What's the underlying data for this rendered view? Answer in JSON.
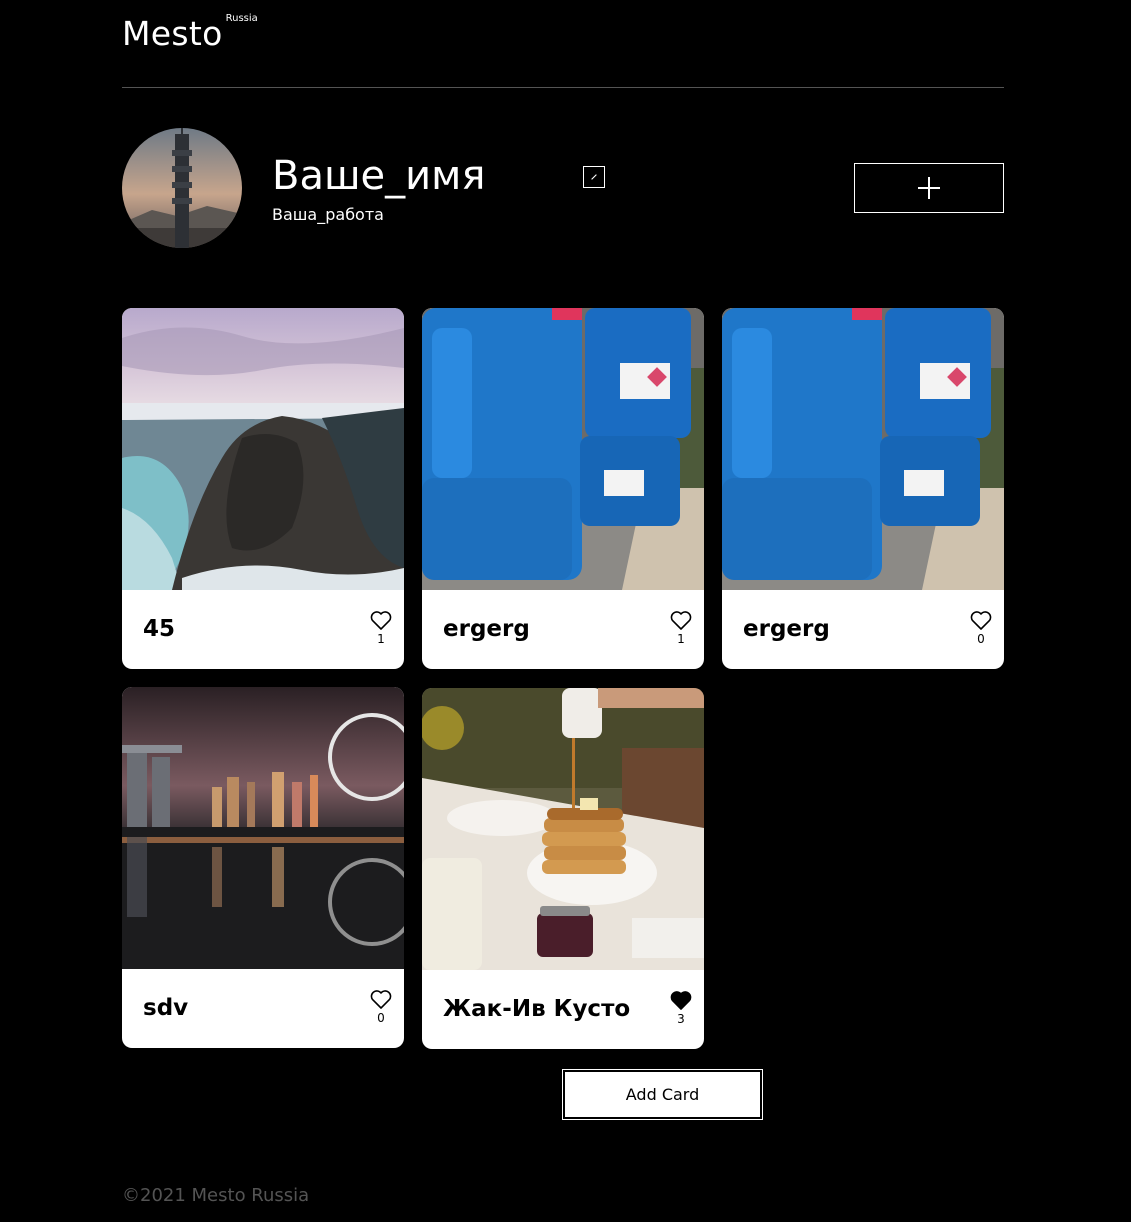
{
  "header": {
    "logo": "Mesto",
    "logo_sup": "Russia"
  },
  "profile": {
    "name": "Ваше_имя",
    "job": "Ваша_работа",
    "edit_icon": "pencil-icon",
    "add_icon": "plus-icon"
  },
  "cards": [
    {
      "title": "45",
      "likes": "1",
      "liked": false,
      "image": "snowy-cliff-photo"
    },
    {
      "title": "ergerg",
      "likes": "1",
      "liked": false,
      "image": "blue-canisters-photo"
    },
    {
      "title": "ergerg",
      "likes": "0",
      "liked": false,
      "image": "blue-canisters-photo"
    },
    {
      "title": "sdv",
      "likes": "0",
      "liked": false,
      "image": "night-city-photo"
    },
    {
      "title": "Жак-Ив Кусто",
      "likes": "3",
      "liked": true,
      "image": "pancakes-photo"
    }
  ],
  "add_card_label": "Add Card",
  "footer": "©2021 Mesto Russia",
  "colors": {
    "background": "#000000",
    "card": "#ffffff",
    "footer_text": "#545454"
  }
}
